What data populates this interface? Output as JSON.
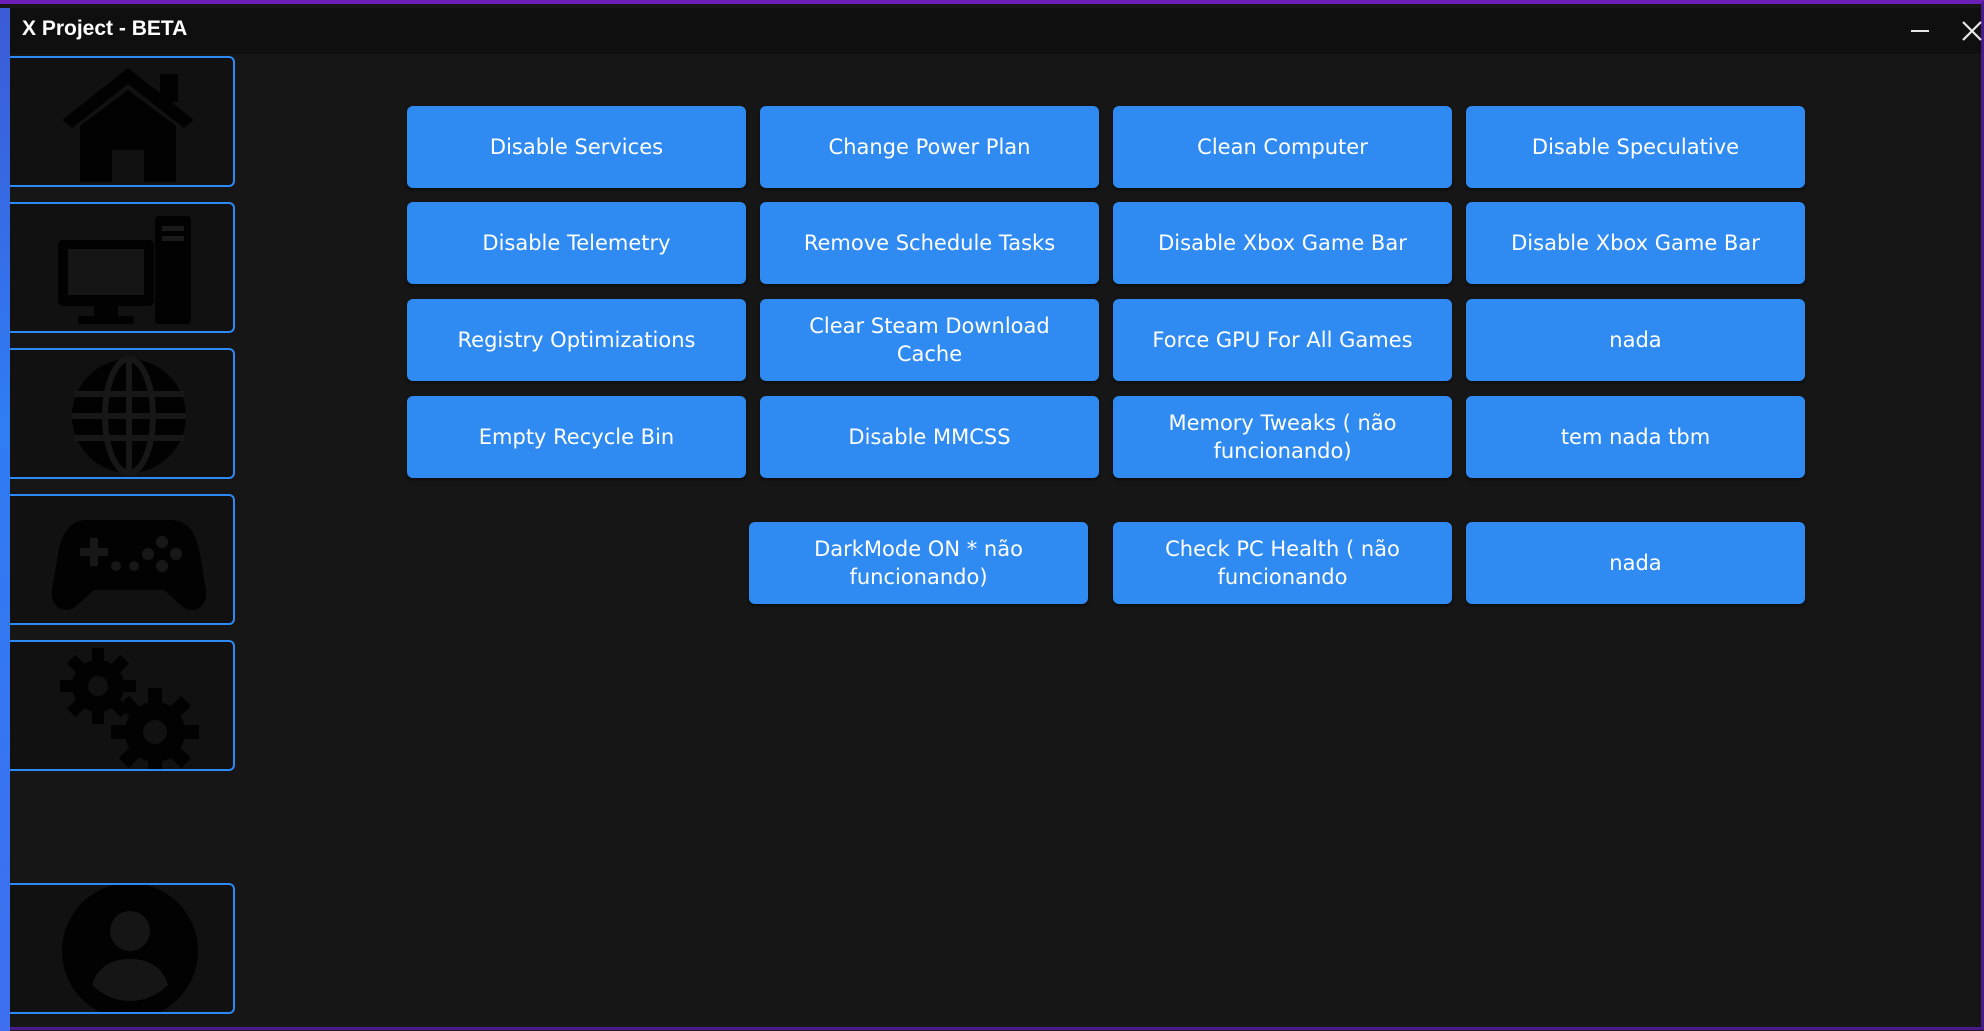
{
  "window": {
    "title": "X Project - BETA",
    "minimize_icon": "minimize-icon",
    "close_icon": "close-icon",
    "accent_color": "#2f8bf2",
    "border_color": "#6b1fb8"
  },
  "sidebar": {
    "items": [
      {
        "name": "home",
        "icon": "home-icon"
      },
      {
        "name": "computer",
        "icon": "computer-icon"
      },
      {
        "name": "network",
        "icon": "globe-icon"
      },
      {
        "name": "games",
        "icon": "gamepad-icon"
      },
      {
        "name": "settings",
        "icon": "gears-icon"
      },
      {
        "name": "profile",
        "icon": "user-icon"
      }
    ]
  },
  "main": {
    "buttons": [
      "Disable Services",
      "Change Power Plan",
      "Clean Computer",
      "Disable Speculative",
      "Disable Telemetry",
      "Remove Schedule Tasks",
      "Disable Xbox Game Bar",
      "Disable Xbox Game Bar",
      "Registry Optimizations",
      "Clear Steam Download Cache",
      "Force GPU For All Games",
      "nada",
      "Empty Recycle Bin",
      "Disable MMCSS",
      "Memory Tweaks ( não funcionando)",
      "tem nada tbm",
      "DarkMode ON * não funcionando)",
      "Check PC Health ( não funcionando",
      "nada"
    ]
  }
}
